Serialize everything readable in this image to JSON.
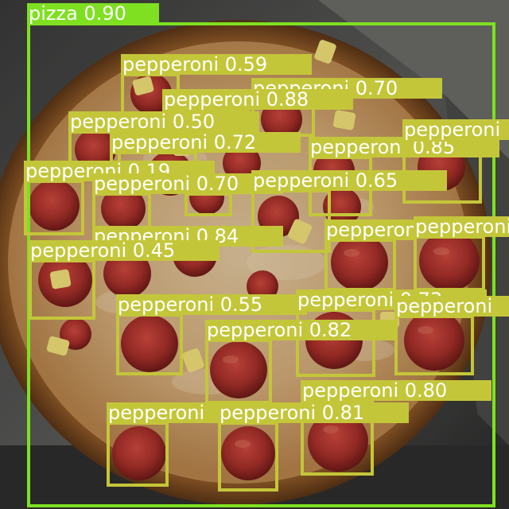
{
  "colors": {
    "pizza": "#7ee021",
    "pepperoni": "#c4c63a",
    "label_text": "#ffffff"
  },
  "detections": [
    {
      "label": "pizza 0.90",
      "class": "pizza",
      "score": 0.9
    },
    {
      "label": "pepperoni 0.59",
      "class": "pepperoni",
      "score": 0.59
    },
    {
      "label": "pepperoni 0.70",
      "class": "pepperoni",
      "score": 0.7
    },
    {
      "label": "pepperoni 0.88",
      "class": "pepperoni",
      "score": 0.88
    },
    {
      "label": "pepperoni 0.50",
      "class": "pepperoni",
      "score": 0.5
    },
    {
      "label": "pepperoni 0.72",
      "class": "pepperoni",
      "score": 0.72
    },
    {
      "label": "pepperoni 0.85",
      "class": "pepperoni",
      "score": 0.85
    },
    {
      "label": "pepperoni",
      "class": "pepperoni"
    },
    {
      "label": "pepperoni 0.19",
      "class": "pepperoni",
      "score": 0.19
    },
    {
      "label": "pepperoni 0.70",
      "class": "pepperoni",
      "score": 0.7
    },
    {
      "label": "pepperoni 0.65",
      "class": "pepperoni",
      "score": 0.65
    },
    {
      "label": "pepperoni 0.84",
      "class": "pepperoni",
      "score": 0.84
    },
    {
      "label": "pepperoni",
      "class": "pepperoni"
    },
    {
      "label": "pepperoni",
      "class": "pepperoni"
    },
    {
      "label": "pepperoni 0.45",
      "class": "pepperoni",
      "score": 0.45
    },
    {
      "label": "pepperoni 0.55",
      "class": "pepperoni",
      "score": 0.55
    },
    {
      "label": "pepperoni 0.73",
      "class": "pepperoni",
      "score": 0.73
    },
    {
      "label": "pepperoni",
      "class": "pepperoni"
    },
    {
      "label": "pepperoni 0.82",
      "class": "pepperoni",
      "score": 0.82
    },
    {
      "label": "pepperoni 0.80",
      "class": "pepperoni",
      "score": 0.8
    },
    {
      "label": "pepperoni",
      "class": "pepperoni"
    },
    {
      "label": "pepperoni 0.81",
      "class": "pepperoni",
      "score": 0.81
    }
  ]
}
